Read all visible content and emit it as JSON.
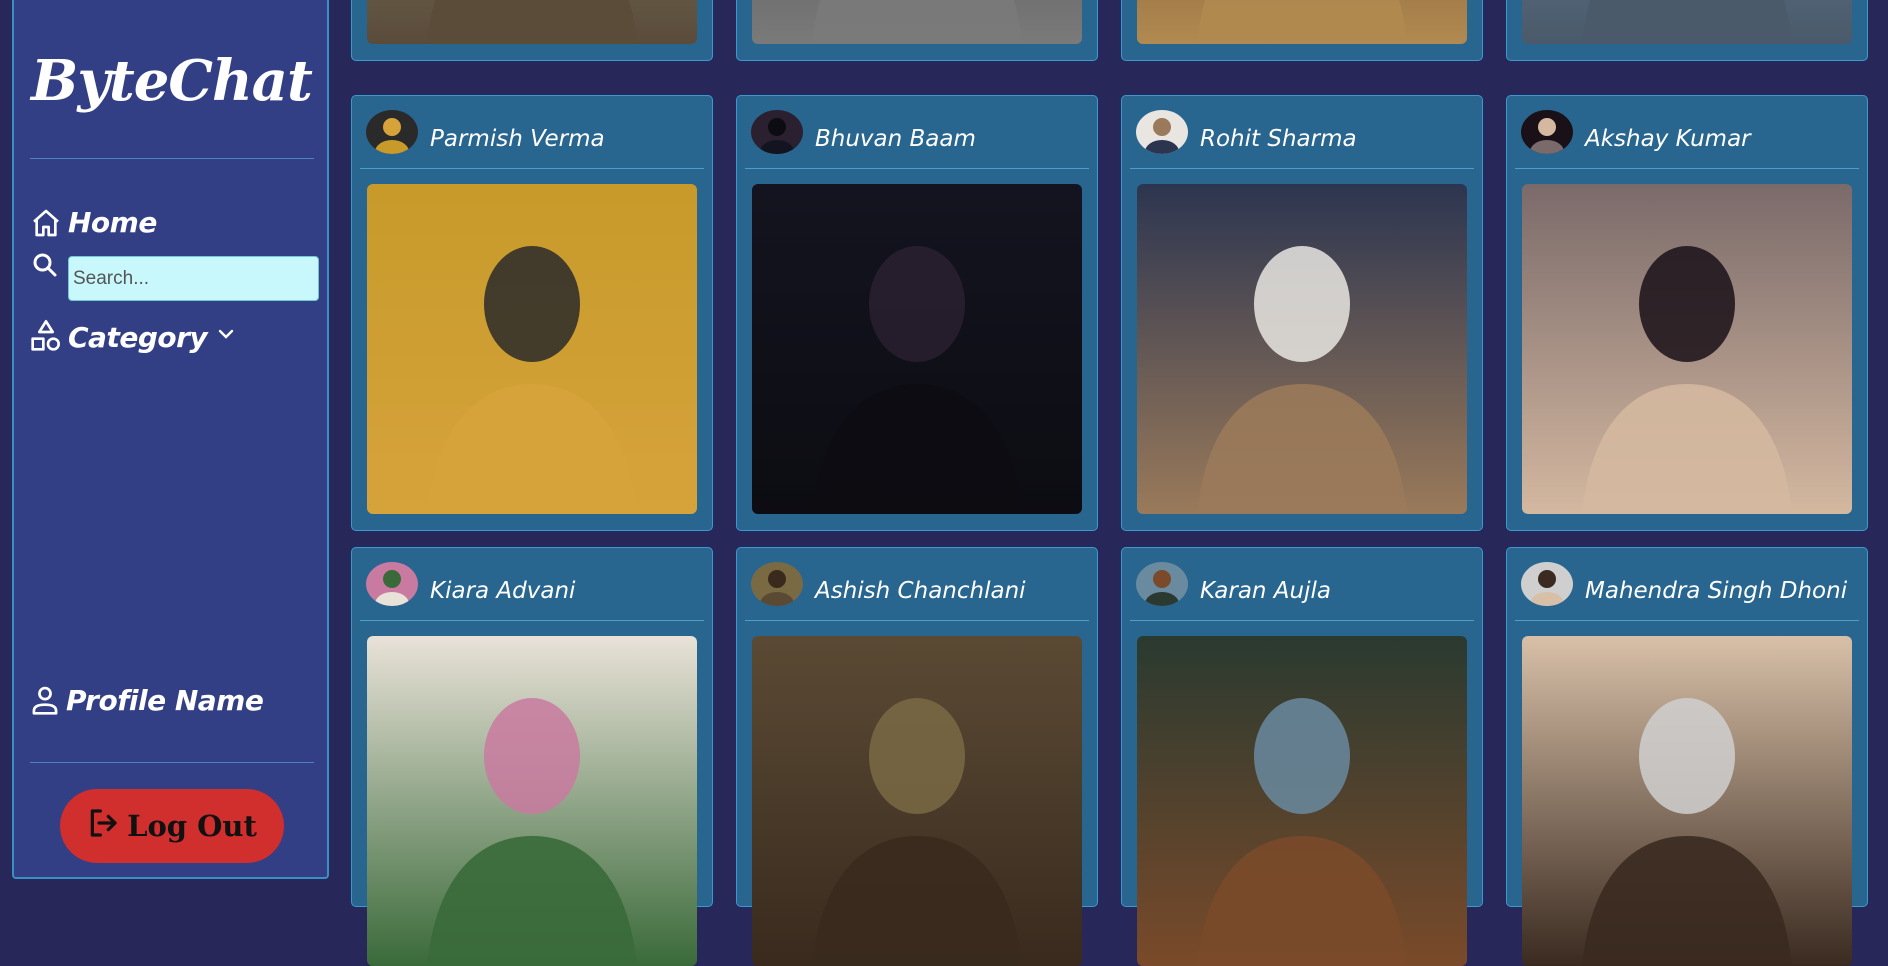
{
  "app": {
    "logo": "ByteChat"
  },
  "sidebar": {
    "home_label": "Home",
    "search_placeholder": "Search...",
    "category_label": "Category",
    "profile_label": "Profile Name",
    "logout_label": "Log Out"
  },
  "colors": {
    "background": "#28275a",
    "sidebar": "#333f85",
    "card": "#286690",
    "search_bg": "#c8f8fc",
    "logout": "#d12e2e"
  },
  "icons": {
    "home": "home-icon",
    "search": "search-icon",
    "category": "shapes-icon",
    "chevron": "chevron-down-icon",
    "profile": "user-icon",
    "logout": "logout-icon"
  },
  "feed": {
    "cards": [
      {
        "name": ""
      },
      {
        "name": ""
      },
      {
        "name": ""
      },
      {
        "name": ""
      },
      {
        "name": "Parmish Verma"
      },
      {
        "name": "Bhuvan Baam"
      },
      {
        "name": "Rohit Sharma"
      },
      {
        "name": "Akshay Kumar"
      },
      {
        "name": "Kiara Advani"
      },
      {
        "name": "Ashish Chanchlani"
      },
      {
        "name": "Karan Aujla"
      },
      {
        "name": "Mahendra Singh Dhoni"
      }
    ]
  }
}
